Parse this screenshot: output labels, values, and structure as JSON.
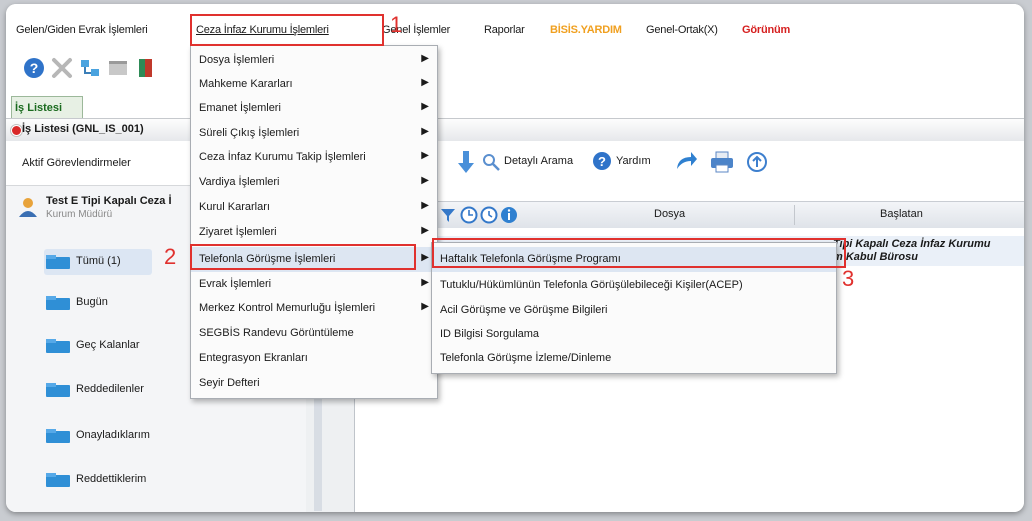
{
  "menubar": {
    "items": [
      {
        "label": "Gelen/Giden Evrak İşlemleri",
        "style": "normal"
      },
      {
        "label": "Ceza İnfaz Kurumu İşlemleri",
        "style": "normal"
      },
      {
        "label": "Genel İşlemler",
        "style": "normal"
      },
      {
        "label": "Raporlar",
        "style": "normal"
      },
      {
        "label": "BİSİS.YARDIM",
        "style": "orange"
      },
      {
        "label": "Genel-Ortak(X)",
        "style": "normal"
      },
      {
        "label": "Görünüm",
        "style": "red"
      }
    ]
  },
  "toolbar": {
    "icons": [
      "help-icon",
      "close-x-icon",
      "network-icon",
      "window-icon",
      "book-icon"
    ]
  },
  "left": {
    "tab_label": "İş Listesi",
    "list_title": "İş Listesi (GNL_IS_001)",
    "active_tasks": "Aktif Görevlendirmeler",
    "user_name": "Test E Tipi Kapalı Ceza İ",
    "user_role": "Kurum Müdürü",
    "folders": [
      {
        "label": "Tümü (1)"
      },
      {
        "label": "Bugün"
      },
      {
        "label": "Geç Kalanlar"
      },
      {
        "label": "Reddedilenler"
      },
      {
        "label": "Onayladıklarım"
      },
      {
        "label": "Reddettiklerim"
      }
    ]
  },
  "right": {
    "toolbar_search": "Detaylı Arama",
    "toolbar_help": "Yardım",
    "grid_col_dosya": "Dosya",
    "grid_col_baslatan": "Başlatan",
    "row1_line1": "Tipi Kapalı Ceza İnfaz Kurumu",
    "row1_line2": "m Kabul Bürosu"
  },
  "menu1": {
    "items": [
      {
        "label": "Dosya İşlemleri",
        "sub": true
      },
      {
        "label": "Mahkeme Kararları",
        "sub": true
      },
      {
        "label": "Emanet İşlemleri",
        "sub": true
      },
      {
        "label": "Süreli Çıkış İşlemleri",
        "sub": true
      },
      {
        "label": "Ceza İnfaz Kurumu Takip İşlemleri",
        "sub": true
      },
      {
        "label": "Vardiya İşlemleri",
        "sub": true
      },
      {
        "label": "Kurul Kararları",
        "sub": true
      },
      {
        "label": "Ziyaret İşlemleri",
        "sub": true
      },
      {
        "label": "Telefonla Görüşme İşlemleri",
        "sub": true
      },
      {
        "label": "Evrak İşlemleri",
        "sub": true
      },
      {
        "label": "Merkez Kontrol Memurluğu İşlemleri",
        "sub": true
      },
      {
        "label": "SEGBİS Randevu Görüntüleme",
        "sub": false
      },
      {
        "label": "Entegrasyon Ekranları",
        "sub": false
      },
      {
        "label": "Seyir Defteri",
        "sub": false
      }
    ]
  },
  "menu2": {
    "items": [
      {
        "label": "Haftalık Telefonla Görüşme Programı"
      },
      {
        "label": "Tutuklu/Hükümlünün Telefonla Görüşülebileceği Kişiler(ACEP)"
      },
      {
        "label": "Acil Görüşme ve Görüşme Bilgileri"
      },
      {
        "label": "ID Bilgisi Sorgulama"
      },
      {
        "label": "Telefonla Görüşme İzleme/Dinleme"
      }
    ]
  },
  "callouts": [
    "1",
    "2",
    "3"
  ],
  "colors": {
    "highlight": "#e0312e",
    "brand_orange": "#f0a020"
  }
}
